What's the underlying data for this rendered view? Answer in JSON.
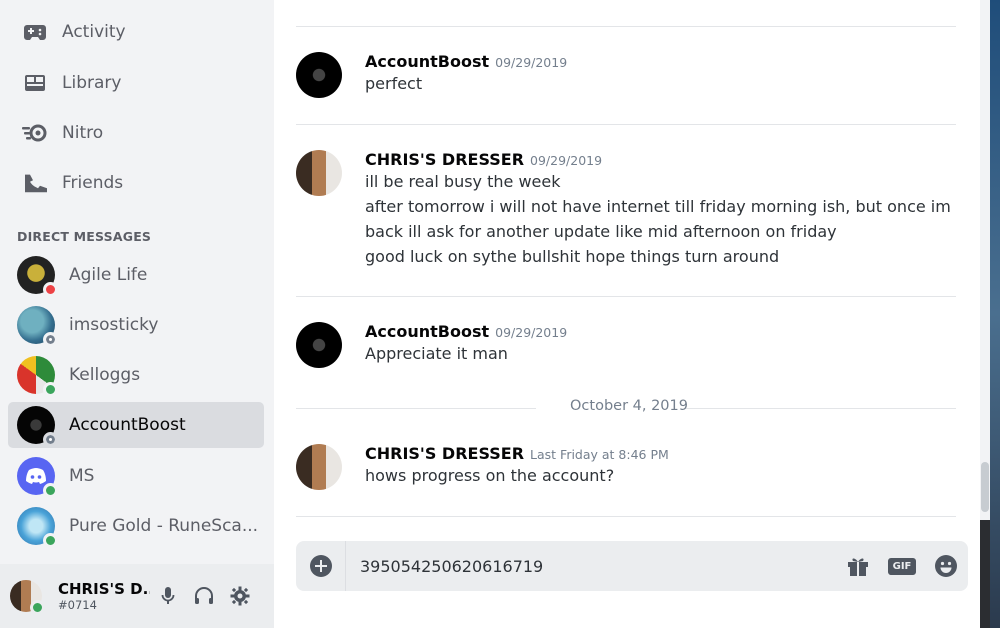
{
  "sidebar": {
    "nav": [
      {
        "label": "Activity",
        "icon": "gamepad-icon"
      },
      {
        "label": "Library",
        "icon": "library-icon"
      },
      {
        "label": "Nitro",
        "icon": "nitro-icon"
      },
      {
        "label": "Friends",
        "icon": "friends-icon"
      }
    ],
    "dm_header": "DIRECT MESSAGES",
    "dms": [
      {
        "name": "Agile Life",
        "status": "dnd"
      },
      {
        "name": "imsosticky",
        "status": "offline"
      },
      {
        "name": "Kelloggs",
        "status": "online"
      },
      {
        "name": "AccountBoost",
        "status": "offline",
        "active": true
      },
      {
        "name": "MS",
        "status": "online"
      },
      {
        "name": "Pure Gold - RuneSca...",
        "status": "online"
      }
    ]
  },
  "user": {
    "name": "CHRIS'S D...",
    "tag": "#0714"
  },
  "chat": {
    "messages": [
      {
        "author": "AccountBoost",
        "timestamp": "09/29/2019",
        "lines": [
          "perfect"
        ]
      },
      {
        "author": "CHRIS'S DRESSER",
        "timestamp": "09/29/2019",
        "lines": [
          "ill be real busy the week",
          "after tomorrow i will not have internet till friday morning ish, but once im",
          "back ill ask for another update like mid afternoon on friday",
          "good luck on sythe bullshit hope things turn around"
        ]
      },
      {
        "author": "AccountBoost",
        "timestamp": "09/29/2019",
        "lines": [
          "Appreciate it man"
        ]
      },
      {
        "author": "CHRIS'S DRESSER",
        "timestamp": "Last Friday at 8:46 PM",
        "lines": [
          "hows progress on the account?"
        ]
      }
    ],
    "date_separator": "October 4, 2019",
    "composer_value": "395054250620616719",
    "gif_label": "GIF"
  },
  "colors": {
    "online": "#3ba55c",
    "dnd": "#ed4245",
    "offline": "#747f8d",
    "blurple": "#5865f2"
  }
}
